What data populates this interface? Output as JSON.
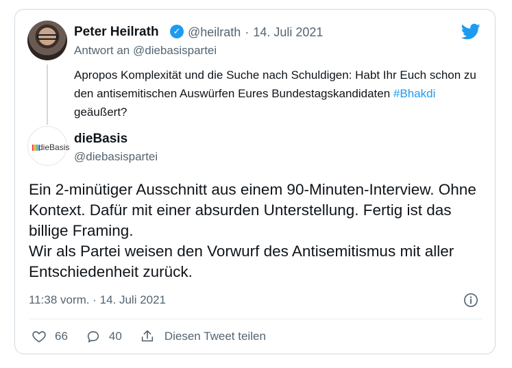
{
  "tweet": {
    "author_name": "Peter Heilrath",
    "author_handle": "@heilrath",
    "date": "14. Juli 2021",
    "reply_to": "Antwort an @diebasispartei",
    "text_before": "Apropos Komplexität und die Suche nach Schuldigen: Habt Ihr Euch schon zu den antisemitischen Auswürfen Eures Bundestagskandidaten ",
    "hashtag": "#Bhakdi",
    "text_after": " geäußert?"
  },
  "reply": {
    "author_name": "dieBasis",
    "author_handle": "@diebasispartei",
    "logo_text": "dieBasis",
    "paragraph1": "Ein 2-minütiger Ausschnitt aus einem 90-Minuten-Interview. Ohne Kontext. Dafür mit einer absurden Unterstellung. Fertig ist das billige Framing.",
    "paragraph2": "Wir als Partei weisen den Vorwurf des Antisemitismus mit aller Entschiedenheit zurück.",
    "timestamp": "11:38 vorm. · 14. Juli 2021"
  },
  "actions": {
    "likes": "66",
    "replies": "40",
    "share_label": "Diesen Tweet teilen"
  },
  "icons": {
    "platform": "twitter-bird-icon",
    "verified": "verified-badge-icon",
    "info": "info-icon",
    "like": "heart-icon",
    "reply": "comment-icon",
    "share": "share-icon"
  },
  "colors": {
    "accent": "#1d9bf0",
    "secondary_text": "#536471",
    "border": "#cfd9de"
  }
}
